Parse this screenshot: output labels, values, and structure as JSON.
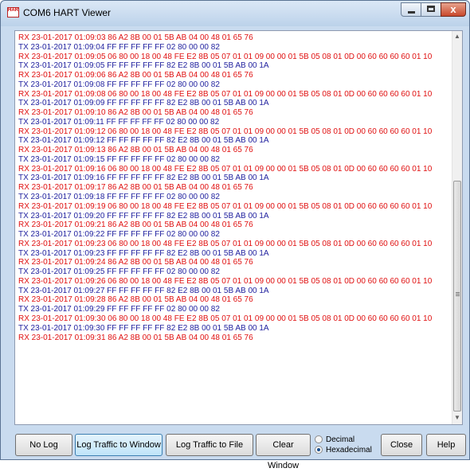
{
  "window": {
    "title": "COM6 HART Viewer",
    "icon_text": "HART",
    "close_glyph": "x"
  },
  "log": {
    "lines": [
      {
        "dir": "rx",
        "text": "RX 23-01-2017 01:09:03 86 A2 8B 00 01 5B AB 04 00 48 01 65 76"
      },
      {
        "dir": "tx",
        "text": "TX 23-01-2017 01:09:04 FF FF FF FF FF 02 80 00 00 82"
      },
      {
        "dir": "rx",
        "text": "RX 23-01-2017 01:09:05 06 80 00 18 00 48 FE E2 8B 05 07 01 01 09 00 00 01 5B 05 08 01 0D 00 60 60 60 60 01 10"
      },
      {
        "dir": "tx",
        "text": "TX 23-01-2017 01:09:05 FF FF FF FF FF 82 E2 8B 00 01 5B AB 00 1A"
      },
      {
        "dir": "rx",
        "text": "RX 23-01-2017 01:09:06 86 A2 8B 00 01 5B AB 04 00 48 01 65 76"
      },
      {
        "dir": "tx",
        "text": "TX 23-01-2017 01:09:08 FF FF FF FF FF 02 80 00 00 82"
      },
      {
        "dir": "rx",
        "text": "RX 23-01-2017 01:09:08 06 80 00 18 00 48 FE E2 8B 05 07 01 01 09 00 00 01 5B 05 08 01 0D 00 60 60 60 60 01 10"
      },
      {
        "dir": "tx",
        "text": "TX 23-01-2017 01:09:09 FF FF FF FF FF 82 E2 8B 00 01 5B AB 00 1A"
      },
      {
        "dir": "rx",
        "text": "RX 23-01-2017 01:09:10 86 A2 8B 00 01 5B AB 04 00 48 01 65 76"
      },
      {
        "dir": "tx",
        "text": "TX 23-01-2017 01:09:11 FF FF FF FF FF 02 80 00 00 82"
      },
      {
        "dir": "rx",
        "text": "RX 23-01-2017 01:09:12 06 80 00 18 00 48 FE E2 8B 05 07 01 01 09 00 00 01 5B 05 08 01 0D 00 60 60 60 60 01 10"
      },
      {
        "dir": "tx",
        "text": "TX 23-01-2017 01:09:12 FF FF FF FF FF 82 E2 8B 00 01 5B AB 00 1A"
      },
      {
        "dir": "rx",
        "text": "RX 23-01-2017 01:09:13 86 A2 8B 00 01 5B AB 04 00 48 01 65 76"
      },
      {
        "dir": "tx",
        "text": "TX 23-01-2017 01:09:15 FF FF FF FF FF 02 80 00 00 82"
      },
      {
        "dir": "rx",
        "text": "RX 23-01-2017 01:09:16 06 80 00 18 00 48 FE E2 8B 05 07 01 01 09 00 00 01 5B 05 08 01 0D 00 60 60 60 60 01 10"
      },
      {
        "dir": "tx",
        "text": "TX 23-01-2017 01:09:16 FF FF FF FF FF 82 E2 8B 00 01 5B AB 00 1A"
      },
      {
        "dir": "rx",
        "text": "RX 23-01-2017 01:09:17 86 A2 8B 00 01 5B AB 04 00 48 01 65 76"
      },
      {
        "dir": "tx",
        "text": "TX 23-01-2017 01:09:18 FF FF FF FF FF 02 80 00 00 82"
      },
      {
        "dir": "rx",
        "text": "RX 23-01-2017 01:09:19 06 80 00 18 00 48 FE E2 8B 05 07 01 01 09 00 00 01 5B 05 08 01 0D 00 60 60 60 60 01 10"
      },
      {
        "dir": "tx",
        "text": "TX 23-01-2017 01:09:20 FF FF FF FF FF 82 E2 8B 00 01 5B AB 00 1A"
      },
      {
        "dir": "rx",
        "text": "RX 23-01-2017 01:09:21 86 A2 8B 00 01 5B AB 04 00 48 01 65 76"
      },
      {
        "dir": "tx",
        "text": "TX 23-01-2017 01:09:22 FF FF FF FF FF 02 80 00 00 82"
      },
      {
        "dir": "rx",
        "text": "RX 23-01-2017 01:09:23 06 80 00 18 00 48 FE E2 8B 05 07 01 01 09 00 00 01 5B 05 08 01 0D 00 60 60 60 60 01 10"
      },
      {
        "dir": "tx",
        "text": "TX 23-01-2017 01:09:23 FF FF FF FF FF 82 E2 8B 00 01 5B AB 00 1A"
      },
      {
        "dir": "rx",
        "text": "RX 23-01-2017 01:09:24 86 A2 8B 00 01 5B AB 04 00 48 01 65 76"
      },
      {
        "dir": "tx",
        "text": "TX 23-01-2017 01:09:25 FF FF FF FF FF 02 80 00 00 82"
      },
      {
        "dir": "rx",
        "text": "RX 23-01-2017 01:09:26 06 80 00 18 00 48 FE E2 8B 05 07 01 01 09 00 00 01 5B 05 08 01 0D 00 60 60 60 60 01 10"
      },
      {
        "dir": "tx",
        "text": "TX 23-01-2017 01:09:27 FF FF FF FF FF 82 E2 8B 00 01 5B AB 00 1A"
      },
      {
        "dir": "rx",
        "text": "RX 23-01-2017 01:09:28 86 A2 8B 00 01 5B AB 04 00 48 01 65 76"
      },
      {
        "dir": "tx",
        "text": "TX 23-01-2017 01:09:29 FF FF FF FF FF 02 80 00 00 82"
      },
      {
        "dir": "rx",
        "text": "RX 23-01-2017 01:09:30 06 80 00 18 00 48 FE E2 8B 05 07 01 01 09 00 00 01 5B 05 08 01 0D 00 60 60 60 60 01 10"
      },
      {
        "dir": "tx",
        "text": "TX 23-01-2017 01:09:30 FF FF FF FF FF 82 E2 8B 00 01 5B AB 00 1A"
      },
      {
        "dir": "rx",
        "text": "RX 23-01-2017 01:09:31 86 A2 8B 00 01 5B AB 04 00 48 01 65 76"
      }
    ]
  },
  "buttons": {
    "no_log": "No Log",
    "log_window": "Log Traffic to Window",
    "log_file": "Log Traffic to File",
    "clear_window": "Clear Window",
    "close": "Close",
    "help": "Help"
  },
  "format": {
    "decimal": "Decimal",
    "hexadecimal": "Hexadecimal",
    "selected": "hexadecimal"
  },
  "colors": {
    "rx": "#e01010",
    "tx": "#1f1f9e",
    "active_button": "#bfe4f9"
  }
}
